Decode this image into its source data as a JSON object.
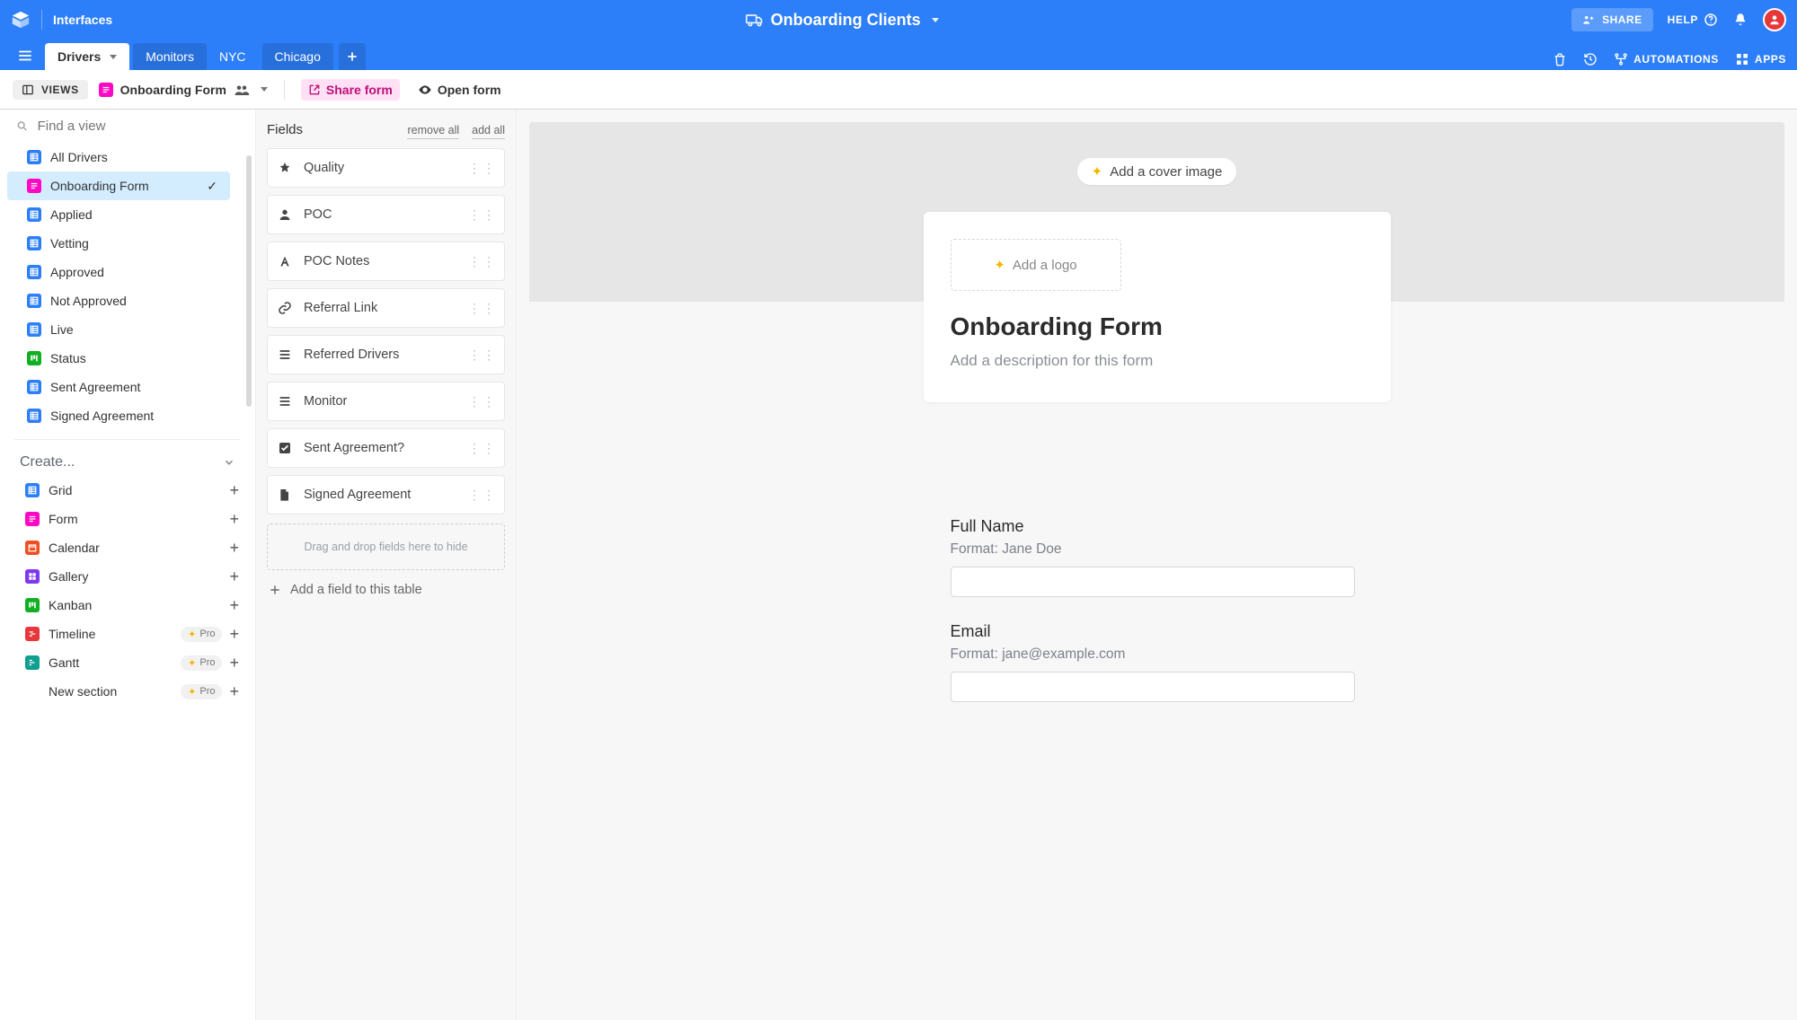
{
  "header": {
    "interfaces": "Interfaces",
    "base_title": "Onboarding Clients",
    "share": "SHARE",
    "help": "HELP",
    "automations": "AUTOMATIONS",
    "apps": "APPS"
  },
  "tabs": {
    "items": [
      "Drivers",
      "Monitors",
      "NYC",
      "Chicago"
    ],
    "active_index": 0
  },
  "viewbar": {
    "views_label": "VIEWS",
    "view_name": "Onboarding Form",
    "share_form": "Share form",
    "open_form": "Open form"
  },
  "views_pane": {
    "search_placeholder": "Find a view",
    "items": [
      {
        "label": "All Drivers",
        "type": "grid"
      },
      {
        "label": "Onboarding Form",
        "type": "form",
        "active": true
      },
      {
        "label": "Applied",
        "type": "grid"
      },
      {
        "label": "Vetting",
        "type": "grid"
      },
      {
        "label": "Approved",
        "type": "grid"
      },
      {
        "label": "Not Approved",
        "type": "grid"
      },
      {
        "label": "Live",
        "type": "grid"
      },
      {
        "label": "Status",
        "type": "kanban"
      },
      {
        "label": "Sent Agreement",
        "type": "grid"
      },
      {
        "label": "Signed Agreement",
        "type": "grid"
      }
    ],
    "create_label": "Create...",
    "create_items": [
      {
        "label": "Grid",
        "type": "grid"
      },
      {
        "label": "Form",
        "type": "form"
      },
      {
        "label": "Calendar",
        "type": "cal"
      },
      {
        "label": "Gallery",
        "type": "gal"
      },
      {
        "label": "Kanban",
        "type": "kanban"
      },
      {
        "label": "Timeline",
        "type": "tl",
        "pro": true
      },
      {
        "label": "Gantt",
        "type": "gantt",
        "pro": true
      },
      {
        "label": "New section",
        "type": "none",
        "pro": true
      }
    ],
    "pro_badge": "Pro"
  },
  "fields_pane": {
    "title": "Fields",
    "remove_all": "remove all",
    "add_all": "add all",
    "items": [
      {
        "label": "Quality",
        "icon": "star"
      },
      {
        "label": "POC",
        "icon": "person"
      },
      {
        "label": "POC Notes",
        "icon": "text-a"
      },
      {
        "label": "Referral Link",
        "icon": "link"
      },
      {
        "label": "Referred Drivers",
        "icon": "list"
      },
      {
        "label": "Monitor",
        "icon": "list"
      },
      {
        "label": "Sent Agreement?",
        "icon": "check"
      },
      {
        "label": "Signed Agreement",
        "icon": "file"
      }
    ],
    "drop_hint": "Drag and drop fields here to hide",
    "add_field": "Add a field to this table"
  },
  "preview": {
    "cover_btn": "Add a cover image",
    "logo_btn": "Add a logo",
    "form_title": "Onboarding Form",
    "form_desc": "Add a description for this form",
    "fields": [
      {
        "label": "Full Name",
        "hint": "Format: Jane Doe"
      },
      {
        "label": "Email",
        "hint": "Format: jane@example.com"
      }
    ]
  }
}
